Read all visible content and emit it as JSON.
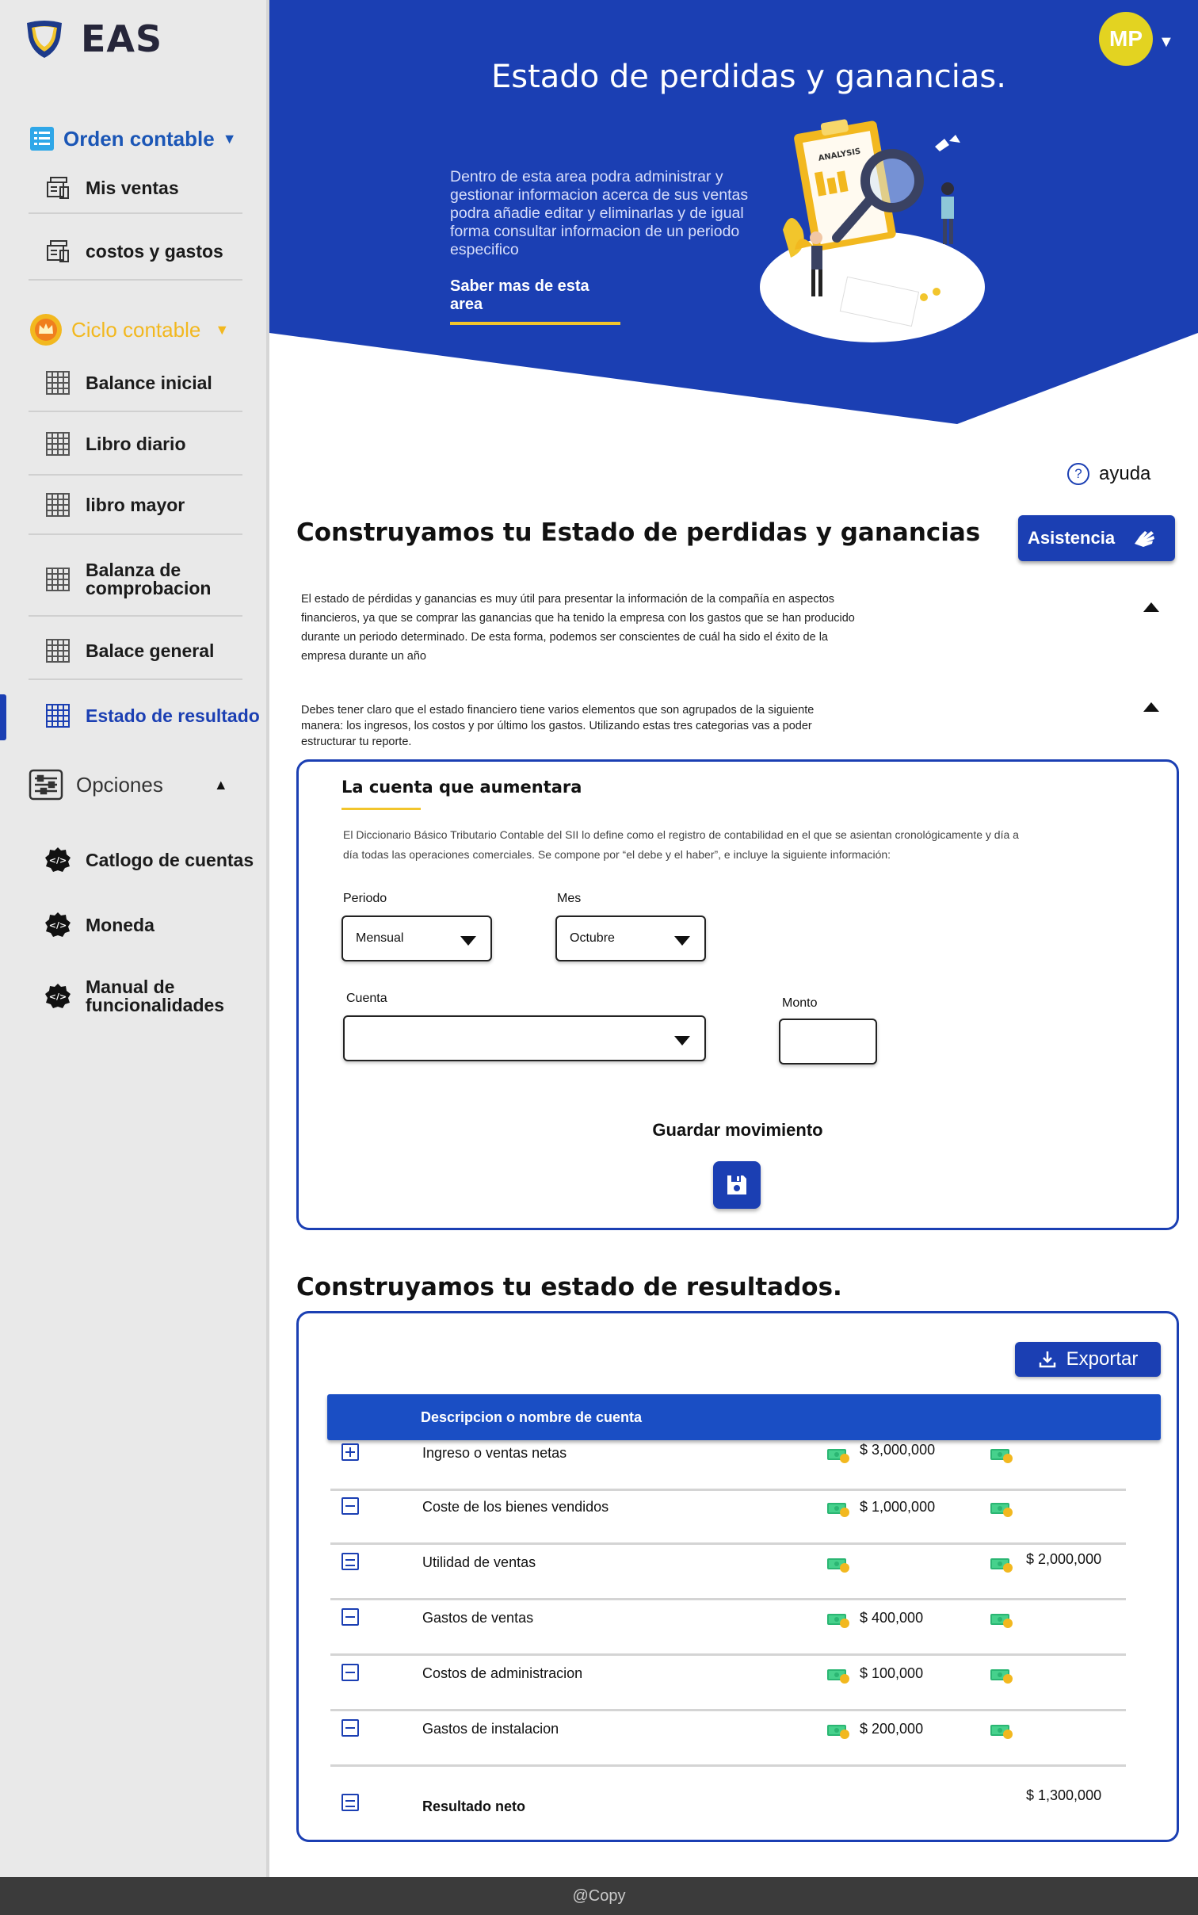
{
  "brand": {
    "name": "EAS"
  },
  "user": {
    "initials": "MP"
  },
  "sidebar": {
    "orden": {
      "label": "Orden contable",
      "items": [
        {
          "label": "Mis ventas"
        },
        {
          "label": "costos y gastos"
        }
      ]
    },
    "ciclo": {
      "label": "Ciclo contable",
      "items": [
        {
          "label": "Balance inicial"
        },
        {
          "label": "Libro diario"
        },
        {
          "label": "libro mayor"
        },
        {
          "label": "Balanza de comprobacion"
        },
        {
          "label": "Balace general"
        },
        {
          "label": "Estado de resultado"
        }
      ]
    },
    "opciones": {
      "label": "Opciones",
      "items": [
        {
          "label": "Catlogo de cuentas"
        },
        {
          "label": "Moneda"
        },
        {
          "label": "Manual de funcionalidades"
        }
      ]
    }
  },
  "hero": {
    "title": "Estado de perdidas y ganancias.",
    "description": "Dentro de esta area podra administrar y gestionar informacion acerca de sus ventas podra añadie editar y eliminarlas y de igual forma consultar informacion de un periodo especifico",
    "link": "Saber mas de esta area",
    "illustration_text": "ANALYSIS"
  },
  "help": {
    "label": "ayuda",
    "icon": "?"
  },
  "builder": {
    "title": "Construyamos tu Estado de perdidas y ganancias",
    "assist_label": "Asistencia",
    "para1": "El estado de pérdidas y ganancias es muy útil para presentar la información de la compañía en aspectos financieros, ya que se comprar las ganancias que ha tenido la empresa con los gastos que se han producido durante un periodo determinado. De esta forma, podemos ser conscientes de cuál ha sido el éxito de la empresa durante un año",
    "para2": "Debes tener claro que el estado financiero tiene varios elementos que son agrupados de la siguiente manera: los ingresos, los costos y por último los gastos. Utilizando estas tres categorias vas a poder estructurar tu reporte."
  },
  "form": {
    "title": "La cuenta que aumentara",
    "description": "El Diccionario Básico Tributario Contable del SII lo define como el registro de contabilidad en el que se asientan cronológicamente y día a día todas las operaciones comerciales. Se compone por “el debe y el haber”, e incluye la siguiente información:",
    "periodo_label": "Periodo",
    "periodo_value": "Mensual",
    "mes_label": "Mes",
    "mes_value": "Octubre",
    "cuenta_label": "Cuenta",
    "cuenta_value": "",
    "monto_label": "Monto",
    "monto_value": "",
    "save_label": "Guardar movimiento"
  },
  "results": {
    "title": "Construyamos tu estado de resultados.",
    "export_label": "Exportar",
    "header": "Descripcion o nombre  de cuenta",
    "rows": [
      {
        "icon": "plus",
        "name": "Ingreso o ventas netas",
        "amount1": "$ 3,000,000",
        "amount2": ""
      },
      {
        "icon": "minus",
        "name": "Coste de los bienes vendidos",
        "amount1": "$ 1,000,000",
        "amount2": ""
      },
      {
        "icon": "equals",
        "name": "Utilidad de ventas",
        "amount1": "",
        "amount2": "$ 2,000,000"
      },
      {
        "icon": "minus",
        "name": "Gastos de ventas",
        "amount1": "$ 400,000",
        "amount2": ""
      },
      {
        "icon": "minus",
        "name": "Costos de administracion",
        "amount1": "$ 100,000",
        "amount2": ""
      },
      {
        "icon": "minus",
        "name": "Gastos de instalacion",
        "amount1": "$ 200,000",
        "amount2": ""
      },
      {
        "icon": "equals",
        "name": "Resultado neto",
        "amount1": "",
        "amount2": "$ 1,300,000"
      }
    ]
  },
  "footer": {
    "text": "@Copy"
  },
  "colors": {
    "primary": "#1b3fb3",
    "accent": "#f2c52c",
    "header_row": "#1a4ec4",
    "sidebar_bg": "#e9e9e9"
  }
}
